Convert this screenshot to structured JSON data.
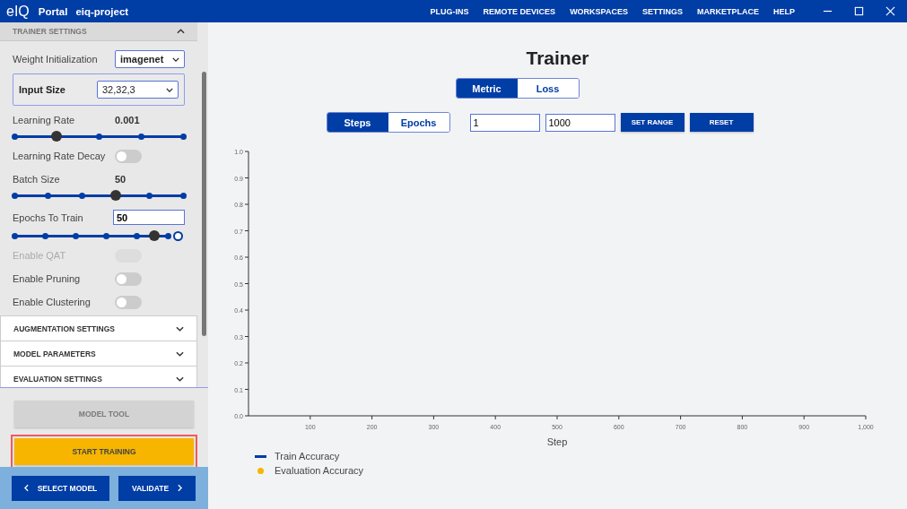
{
  "topbar": {
    "logo": "eIQ",
    "app": "Portal",
    "project": "eiq-project",
    "menu": [
      "PLUG-INS",
      "REMOTE DEVICES",
      "WORKSPACES",
      "SETTINGS",
      "MARKETPLACE",
      "HELP"
    ]
  },
  "sidebar": {
    "section_title": "TRAINER SETTINGS",
    "settings": [
      {
        "kind": "select",
        "label": "Weight Initialization",
        "value": "imagenet"
      },
      {
        "kind": "select-box",
        "label": "Input Size",
        "value": "32,32,3"
      },
      {
        "kind": "slider",
        "label": "Learning Rate",
        "reading": "0.001",
        "level": 0.25
      },
      {
        "kind": "toggle",
        "label": "Learning Rate Decay",
        "on": false,
        "disabled": false
      },
      {
        "kind": "slider",
        "label": "Batch Size",
        "reading": "50",
        "level": 0.6
      },
      {
        "kind": "input-slider",
        "label": "Epochs To Train",
        "value": "50",
        "level": 0.91
      },
      {
        "kind": "toggle",
        "label": "Enable QAT",
        "on": false,
        "disabled": true
      },
      {
        "kind": "toggle",
        "label": "Enable Pruning",
        "on": false,
        "disabled": false
      },
      {
        "kind": "toggle",
        "label": "Enable Clustering",
        "on": false,
        "disabled": false
      }
    ],
    "sections": [
      {
        "label": "AUGMENTATION SETTINGS",
        "expanded": false
      },
      {
        "label": "MODEL PARAMETERS",
        "expanded": false
      },
      {
        "label": "EVALUATION SETTINGS",
        "expanded": false
      }
    ],
    "actions": [
      {
        "label": "MODEL TOOL",
        "disabled": true,
        "highlighted": false
      },
      {
        "label": "START TRAINING",
        "disabled": false,
        "highlighted": true
      }
    ],
    "nav": [
      {
        "label": "SELECT MODEL"
      },
      {
        "label": "VALIDATE"
      }
    ]
  },
  "main": {
    "title": "Trainer",
    "metric_tabs": [
      {
        "label": "Metric",
        "selected": true
      },
      {
        "label": "Loss",
        "selected": false
      }
    ],
    "axis_tabs": [
      {
        "label": "Steps",
        "selected": true
      },
      {
        "label": "Epochs",
        "selected": false
      }
    ],
    "range_from": "1",
    "range_to": "1000",
    "buttons": [
      "SET RANGE",
      "RESET"
    ],
    "chart_data": {
      "type": "line",
      "xlabel": "Step",
      "xlim": [
        0,
        1000
      ],
      "ylim": [
        0,
        1
      ],
      "xticks": [
        {
          "value": 100,
          "label": "100"
        },
        {
          "value": 200,
          "label": "200"
        },
        {
          "value": 300,
          "label": "300"
        },
        {
          "value": 400,
          "label": "400"
        },
        {
          "value": 500,
          "label": "500"
        },
        {
          "value": 600,
          "label": "600"
        },
        {
          "value": 700,
          "label": "700"
        },
        {
          "value": 800,
          "label": "800"
        },
        {
          "value": 900,
          "label": "900"
        },
        {
          "value": 1000,
          "label": "1,000"
        }
      ],
      "yticks": [
        {
          "value": 0,
          "label": "0.0"
        },
        {
          "value": 0.1,
          "label": "0.1"
        },
        {
          "value": 0.2,
          "label": "0.2"
        },
        {
          "value": 0.3,
          "label": "0.3"
        },
        {
          "value": 0.4,
          "label": "0.4"
        },
        {
          "value": 0.5,
          "label": "0.5"
        },
        {
          "value": 0.6,
          "label": "0.6"
        },
        {
          "value": 0.7,
          "label": "0.7"
        },
        {
          "value": 0.8,
          "label": "0.8"
        },
        {
          "value": 0.9,
          "label": "0.9"
        },
        {
          "value": 1,
          "label": "1.0"
        }
      ]
    },
    "legend": [
      {
        "label": "Train Accuracy",
        "kind": "line",
        "color": "#003da5"
      },
      {
        "label": "Evaluation Accuracy",
        "kind": "dot",
        "color": "#f7b500"
      }
    ]
  }
}
